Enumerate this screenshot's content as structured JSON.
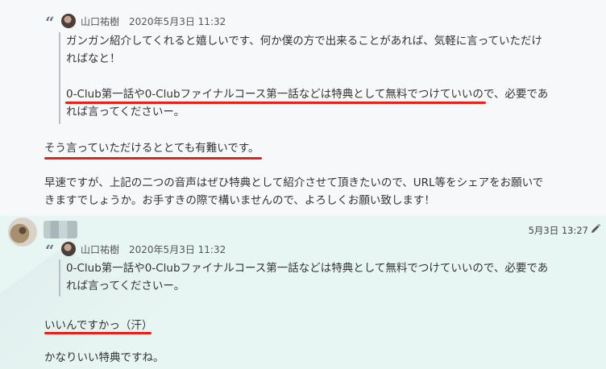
{
  "message1": {
    "quote": {
      "author": "山口祐樹",
      "date": "2020年5月3日 11:32",
      "lines": [
        "ガンガン紹介してくれると嬉しいです、何か僕の方で出来ることがあれば、気軽に言っていただけ",
        "ればなと！",
        "",
        "0-Club第一話や0-Clubファイナルコース第一話などは特典として無料でつけていいので、必要であ",
        "れば言ってくださいー。"
      ]
    },
    "highlight": "そう言っていただけるととても有難いです。",
    "body_lines": [
      "早速ですが、上記の二つの音声はぜひ特典として紹介させて頂きたいので、URL等をシェアをお願いで",
      "きますでしょうか。お手すきの際で構いませんので、よろしくお願い致します！"
    ]
  },
  "message2": {
    "timestamp": "5月3日 13:27",
    "quote": {
      "author": "山口祐樹",
      "date": "2020年5月3日 11:32",
      "lines": [
        "0-Club第一話や0-Clubファイナルコース第一話などは特典として無料でつけていいので、必要であ",
        "れば言ってくださいー。"
      ]
    },
    "highlight": "いいんですかっ（汗）",
    "body": "かなりいい特典ですね。"
  },
  "colors": {
    "underline": "#e8201a",
    "message2_bg": "#e8f6f3",
    "message1_bg": "#f7f8fa"
  },
  "icons": [
    "quote-icon",
    "edit-icon"
  ]
}
